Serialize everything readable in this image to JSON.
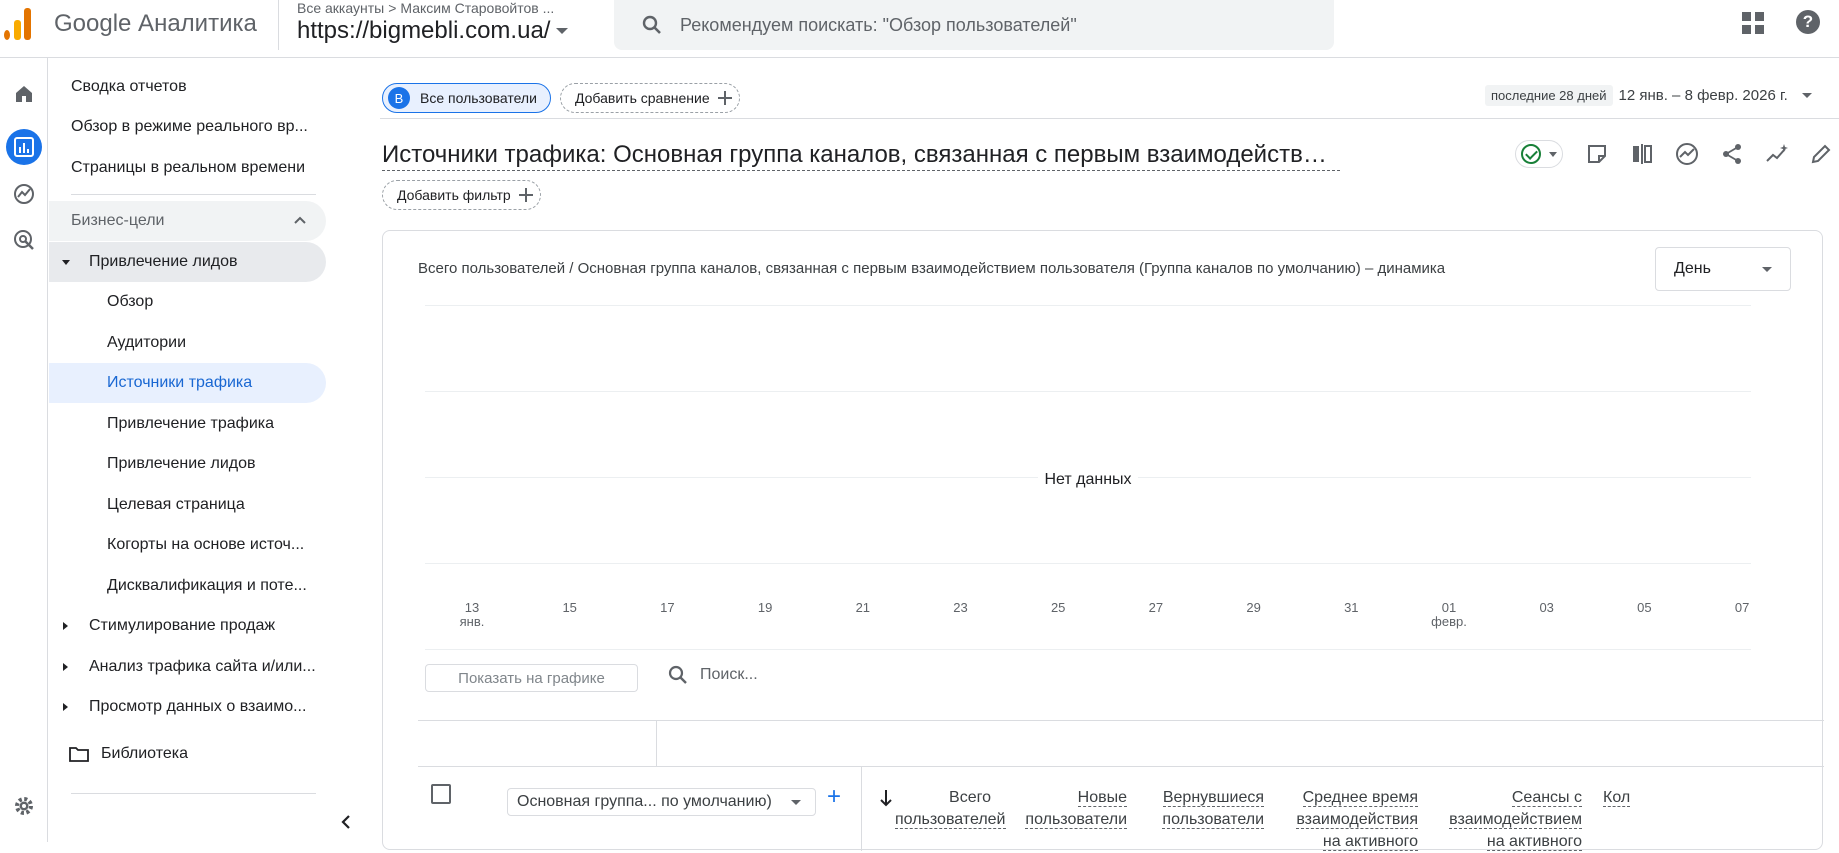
{
  "header": {
    "product": "Google Аналитика",
    "breadcrumb": [
      "Все аккаунты",
      "Максим Старовойтов ..."
    ],
    "property": "https://bigmebli.com.ua/",
    "search_placeholder": "Рекомендуем поискать: \"Обзор пользователей\"",
    "help": "?"
  },
  "nav": {
    "top_items": [
      "Сводка отчетов",
      "Обзор в режиме реального вр...",
      "Страницы в реальном времени"
    ],
    "group": "Бизнес-цели",
    "section": "Привлечение лидов",
    "sub_items": [
      "Обзор",
      "Аудитории",
      "Источники трафика",
      "Привлечение трафика",
      "Привлечение лидов",
      "Целевая страница",
      "Когорты на основе источ...",
      "Дисквалификация и поте..."
    ],
    "collapsed_sections": [
      "Стимулирование продаж",
      "Анализ трафика сайта и/или...",
      "Просмотр данных о взаимо..."
    ],
    "library": "Библиотека"
  },
  "report": {
    "segment_avatar": "B",
    "segment": "Все пользователи",
    "add_comparison": "Добавить сравнение",
    "date_label": "последние 28 дней",
    "date_range": "12 янв. – 8 февр. 2026 г.",
    "title": "Источники трафика: Основная группа каналов, связанная с первым взаимодействием пользователя",
    "add_filter": "Добавить фильтр"
  },
  "chart": {
    "title": "Всего пользователей / Основная группа каналов, связанная с первым взаимодействием пользователя (Группа каналов по умолчанию) – динамика",
    "granularity": "День",
    "no_data": "Нет данных",
    "ticks": [
      {
        "day": "13",
        "month": "янв."
      },
      {
        "day": "15",
        "month": ""
      },
      {
        "day": "17",
        "month": ""
      },
      {
        "day": "19",
        "month": ""
      },
      {
        "day": "21",
        "month": ""
      },
      {
        "day": "23",
        "month": ""
      },
      {
        "day": "25",
        "month": ""
      },
      {
        "day": "27",
        "month": ""
      },
      {
        "day": "29",
        "month": ""
      },
      {
        "day": "31",
        "month": ""
      },
      {
        "day": "01",
        "month": "февр."
      },
      {
        "day": "03",
        "month": ""
      },
      {
        "day": "05",
        "month": ""
      },
      {
        "day": "07",
        "month": ""
      }
    ]
  },
  "table": {
    "show_on_chart": "Показать на графике",
    "search_placeholder": "Поиск...",
    "dimension": "Основная группа... по умолчанию)",
    "add_dimension": "+",
    "columns": [
      [
        "Всего",
        "пользователей"
      ],
      [
        "Новые",
        "пользователи"
      ],
      [
        "Вернувшиеся",
        "пользователи"
      ],
      [
        "Среднее время",
        "взаимодействия",
        "на активного"
      ],
      [
        "Сеансы с",
        "взаимодействием",
        "на активного"
      ],
      [
        "Кол",
        "("
      ]
    ]
  }
}
